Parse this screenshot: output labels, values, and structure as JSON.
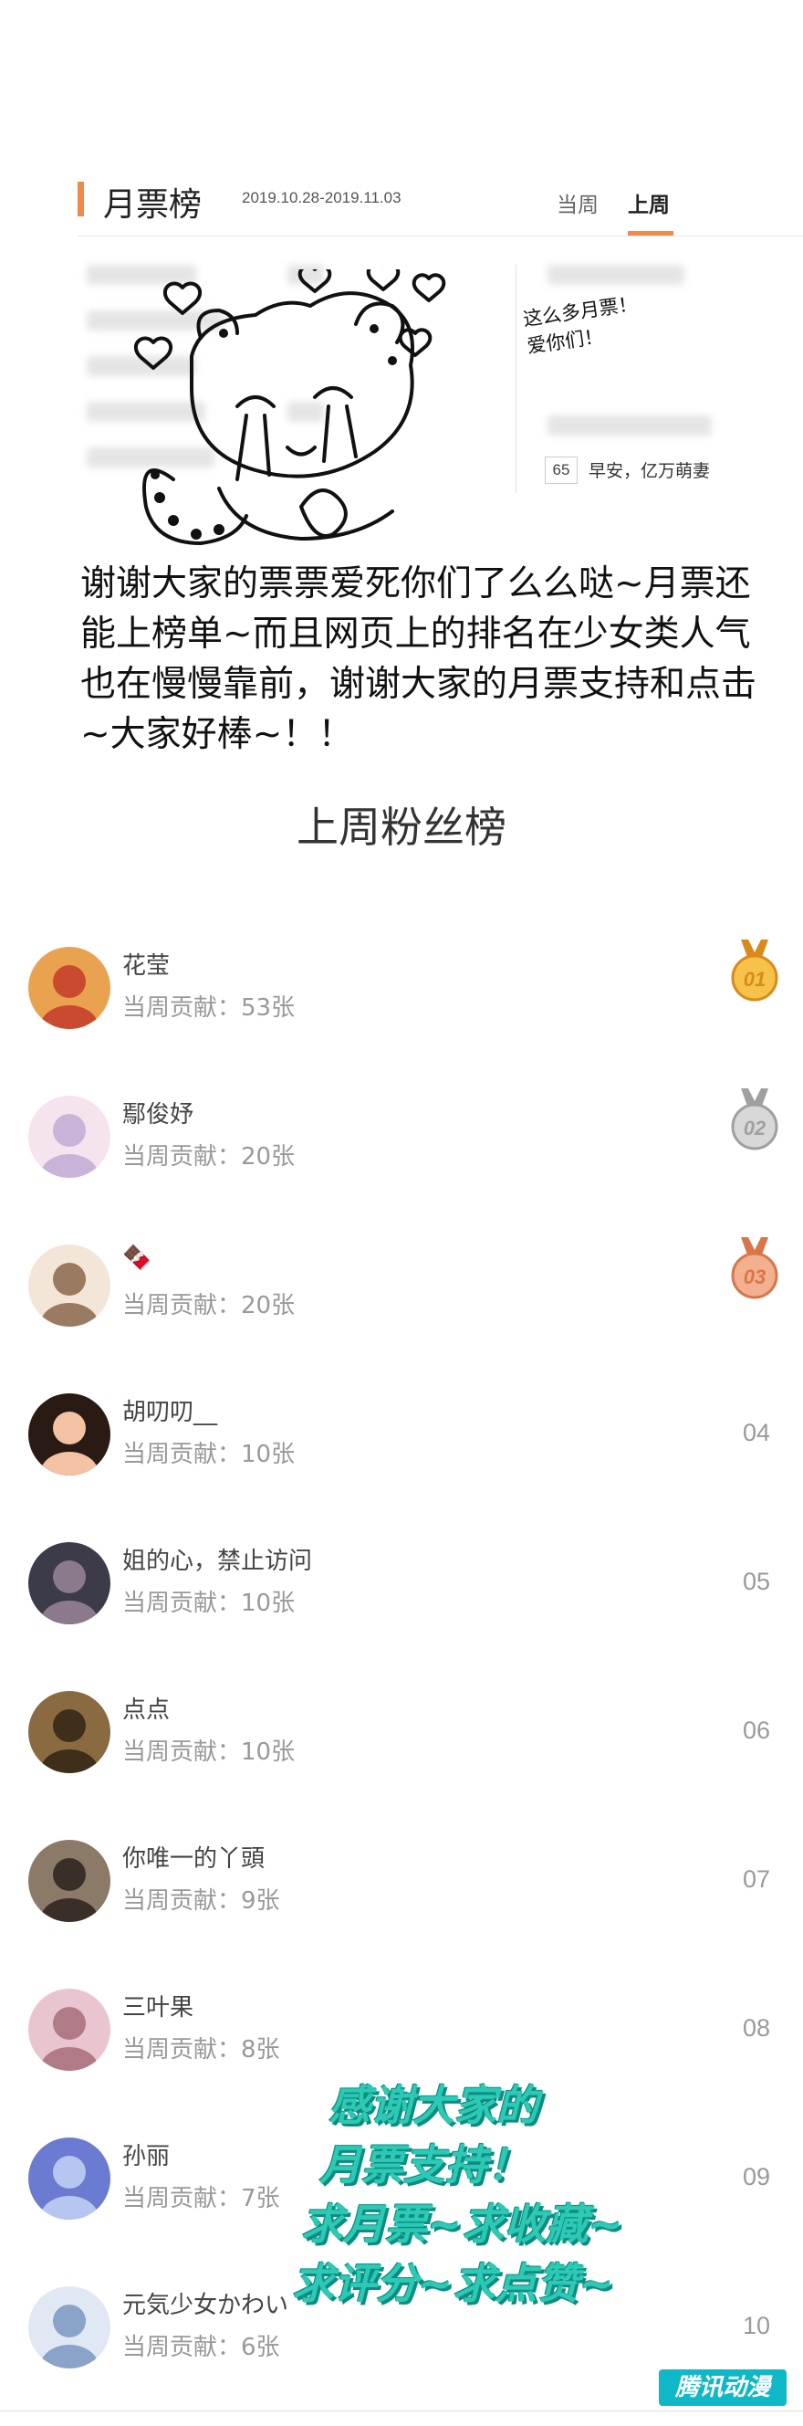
{
  "monthly_ticket": {
    "title": "月票榜",
    "date_range": "2019.10.28-2019.11.03",
    "tabs": [
      "当周",
      "上周"
    ],
    "active_tab": "上周",
    "accent_color": "#f08a4b",
    "visible_entry": {
      "rank": "65",
      "name": "早安，亿万萌妻"
    }
  },
  "drawing_note": "这么多月票！\n爱你们！",
  "message": "谢谢大家的票票爱死你们了么么哒~月票还能上榜单~而且网页上的排名在少女类人气也在慢慢靠前，谢谢大家的月票支持和点击~大家好棒~！！",
  "fans": {
    "title": "上周粉丝榜",
    "list": [
      {
        "name": "花莹",
        "contribution": "当周贡献：53张",
        "rank": "01",
        "medal": "gold"
      },
      {
        "name": "鄢俊妤",
        "contribution": "当周贡献：20张",
        "rank": "02",
        "medal": "silver"
      },
      {
        "name": "🍫",
        "contribution": "当周贡献：20张",
        "rank": "03",
        "medal": "bronze"
      },
      {
        "name": "胡叨叨__",
        "contribution": "当周贡献：10张",
        "rank": "04"
      },
      {
        "name": "姐的心，禁止访问",
        "contribution": "当周贡献：10张",
        "rank": "05"
      },
      {
        "name": "点点",
        "contribution": "当周贡献：10张",
        "rank": "06"
      },
      {
        "name": "你唯一的丫頭",
        "contribution": "当周贡献：9张",
        "rank": "07"
      },
      {
        "name": "三叶果",
        "contribution": "当周贡献：8张",
        "rank": "08"
      },
      {
        "name": "孙丽",
        "contribution": "当周贡献：7张",
        "rank": "09"
      },
      {
        "name": "元気少女かわい",
        "contribution": "当周贡献：6张",
        "rank": "10"
      }
    ]
  },
  "promo": [
    "感谢大家的",
    "月票支持！",
    "求月票~求收藏~",
    "求评分~求点赞~"
  ],
  "watermark": "腾讯动漫"
}
